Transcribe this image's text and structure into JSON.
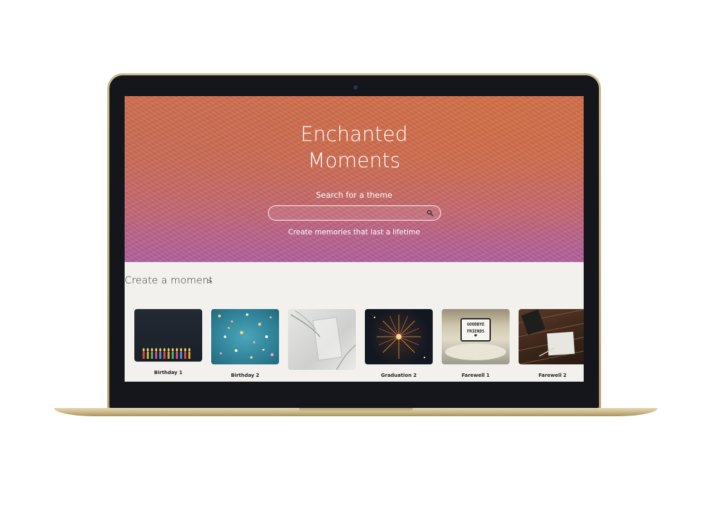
{
  "hero": {
    "title_line1": "Enchanted",
    "title_line2": "Moments",
    "search_label": "Search for a theme",
    "search_value": "",
    "tagline": "Create memories that last a lifetime"
  },
  "section": {
    "title": "Create a moment",
    "arrow": ">"
  },
  "cards": [
    {
      "label": "Birthday 1"
    },
    {
      "label": "Birthday 2"
    },
    {
      "label": ""
    },
    {
      "label": "Graduation 2"
    },
    {
      "label": "Farewell 1"
    },
    {
      "label": "Farewell 2"
    }
  ],
  "thumbnail_sign": {
    "line1": "GOODBYE",
    "line2": "FRIENDS"
  },
  "colors": {
    "lid": "#bfa873",
    "bezel": "#15161b",
    "page_background": "#f2f1ee",
    "hero_top": "#d07050",
    "hero_bottom": "#b2609d"
  }
}
